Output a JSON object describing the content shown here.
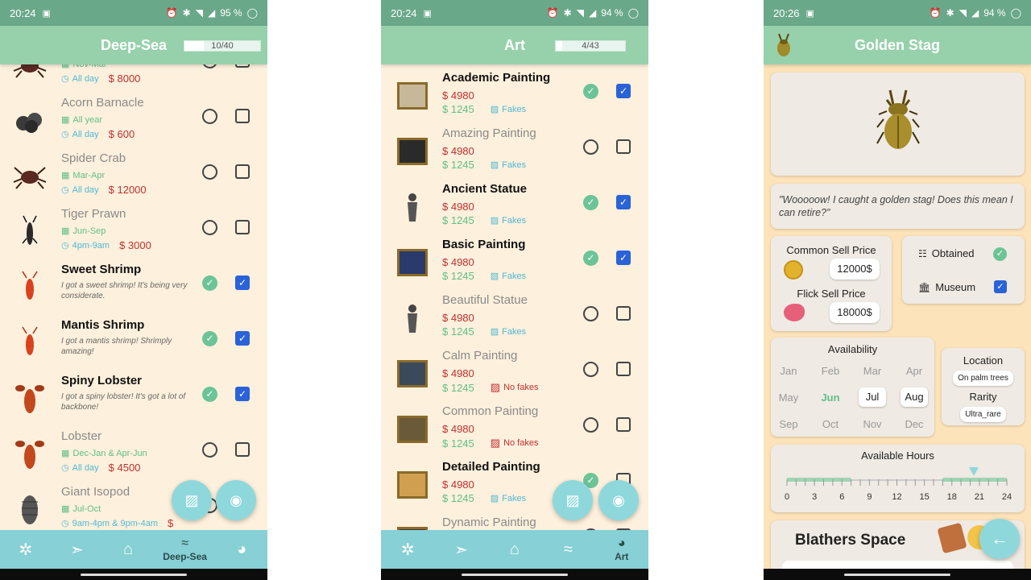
{
  "phone1": {
    "status": {
      "time": "20:24",
      "battery": "95 %"
    },
    "title": "Deep-Sea",
    "progress": {
      "label": "10/40",
      "fraction": 0.25
    },
    "rows": [
      {
        "name": "",
        "months": "Nov-Mar",
        "hours": "All day",
        "price": "8000",
        "caught": false,
        "museum": false,
        "icon": "crab-icon"
      },
      {
        "name": "Acorn Barnacle",
        "months": "All year",
        "hours": "All day",
        "price": "600",
        "caught": false,
        "museum": false,
        "icon": "barnacle-icon"
      },
      {
        "name": "Spider Crab",
        "months": "Mar-Apr",
        "hours": "All day",
        "price": "12000",
        "caught": false,
        "museum": false,
        "icon": "crab-icon"
      },
      {
        "name": "Tiger Prawn",
        "months": "Jun-Sep",
        "hours": "4pm-9am",
        "price": "3000",
        "caught": false,
        "museum": false,
        "icon": "prawn-icon"
      },
      {
        "name": "Sweet Shrimp",
        "quote": "I got a sweet shrimp! It's being very considerate.",
        "caught": true,
        "museum": true,
        "icon": "shrimp-icon"
      },
      {
        "name": "Mantis Shrimp",
        "quote": "I got a mantis shrimp! Shrimply amazing!",
        "caught": true,
        "museum": true,
        "icon": "shrimp-icon"
      },
      {
        "name": "Spiny Lobster",
        "quote": "I got a spiny lobster! It's got a lot of backbone!",
        "caught": true,
        "museum": true,
        "icon": "lobster-icon"
      },
      {
        "name": "Lobster",
        "months": "Dec-Jan & Apr-Jun",
        "hours": "All day",
        "price": "4500",
        "caught": false,
        "museum": false,
        "icon": "lobster-icon"
      },
      {
        "name": "Giant Isopod",
        "months": "Jul-Oct",
        "hours": "9am-4pm & 9pm-4am",
        "price": "",
        "caught": false,
        "museum": false,
        "icon": "isopod-icon"
      }
    ],
    "nav": {
      "active_label": "Deep-Sea"
    }
  },
  "phone2": {
    "status": {
      "time": "20:24",
      "battery": "94 %"
    },
    "title": "Art",
    "progress": {
      "label": "4/43",
      "fraction": 0.09
    },
    "rows": [
      {
        "name": "Academic Painting",
        "buy": "4980",
        "sell": "1245",
        "fakes": "Fakes",
        "has_fakes": true,
        "caught": true,
        "museum": true
      },
      {
        "name": "Amazing Painting",
        "buy": "4980",
        "sell": "1245",
        "fakes": "Fakes",
        "has_fakes": true,
        "caught": false,
        "museum": false
      },
      {
        "name": "Ancient Statue",
        "buy": "4980",
        "sell": "1245",
        "fakes": "Fakes",
        "has_fakes": true,
        "caught": true,
        "museum": true
      },
      {
        "name": "Basic Painting",
        "buy": "4980",
        "sell": "1245",
        "fakes": "Fakes",
        "has_fakes": true,
        "caught": true,
        "museum": true
      },
      {
        "name": "Beautiful Statue",
        "buy": "4980",
        "sell": "1245",
        "fakes": "Fakes",
        "has_fakes": true,
        "caught": false,
        "museum": false
      },
      {
        "name": "Calm Painting",
        "buy": "4980",
        "sell": "1245",
        "fakes": "No fakes",
        "has_fakes": false,
        "caught": false,
        "museum": false
      },
      {
        "name": "Common Painting",
        "buy": "4980",
        "sell": "1245",
        "fakes": "No fakes",
        "has_fakes": false,
        "caught": false,
        "museum": false
      },
      {
        "name": "Detailed Painting",
        "buy": "4980",
        "sell": "1245",
        "fakes": "Fakes",
        "has_fakes": true,
        "caught": true,
        "museum": false
      },
      {
        "name": "Dynamic Painting",
        "buy": "",
        "sell": "",
        "fakes": "",
        "has_fakes": true,
        "caught": false,
        "museum": false
      }
    ],
    "nav": {
      "active_label": "Art"
    }
  },
  "phone3": {
    "status": {
      "time": "20:26",
      "battery": "94 %"
    },
    "title": "Golden Stag",
    "quote": "\"Wooooow! I caught a golden stag! Does this mean I can retire?\"",
    "common_sell_label": "Common Sell Price",
    "common_sell_value": "12000$",
    "flick_sell_label": "Flick Sell Price",
    "flick_sell_value": "18000$",
    "obtained_label": "Obtained",
    "museum_label": "Museum",
    "availability_label": "Availability",
    "months": [
      "Jan",
      "Feb",
      "Mar",
      "Apr",
      "May",
      "Jun",
      "Jul",
      "Aug",
      "Sep",
      "Oct",
      "Nov",
      "Dec"
    ],
    "current_month": "Jun",
    "selected_months": [
      "Jul",
      "Aug"
    ],
    "location_label": "Location",
    "location_value": "On palm trees",
    "rarity_label": "Rarity",
    "rarity_value": "Ultra_rare",
    "hours_label": "Available Hours",
    "hour_ticks": [
      "0",
      "3",
      "6",
      "9",
      "12",
      "15",
      "18",
      "21",
      "24"
    ],
    "current_hour": 20.4,
    "blathers_title": "Blathers Space"
  },
  "colors": {
    "header": "#96d1ac",
    "status": "#6aa88a",
    "nav": "#86d0d6",
    "background": "#fdf0dc",
    "accent_blue": "#2a62d8",
    "accent_green": "#6cc496",
    "price_red": "#c23030"
  }
}
